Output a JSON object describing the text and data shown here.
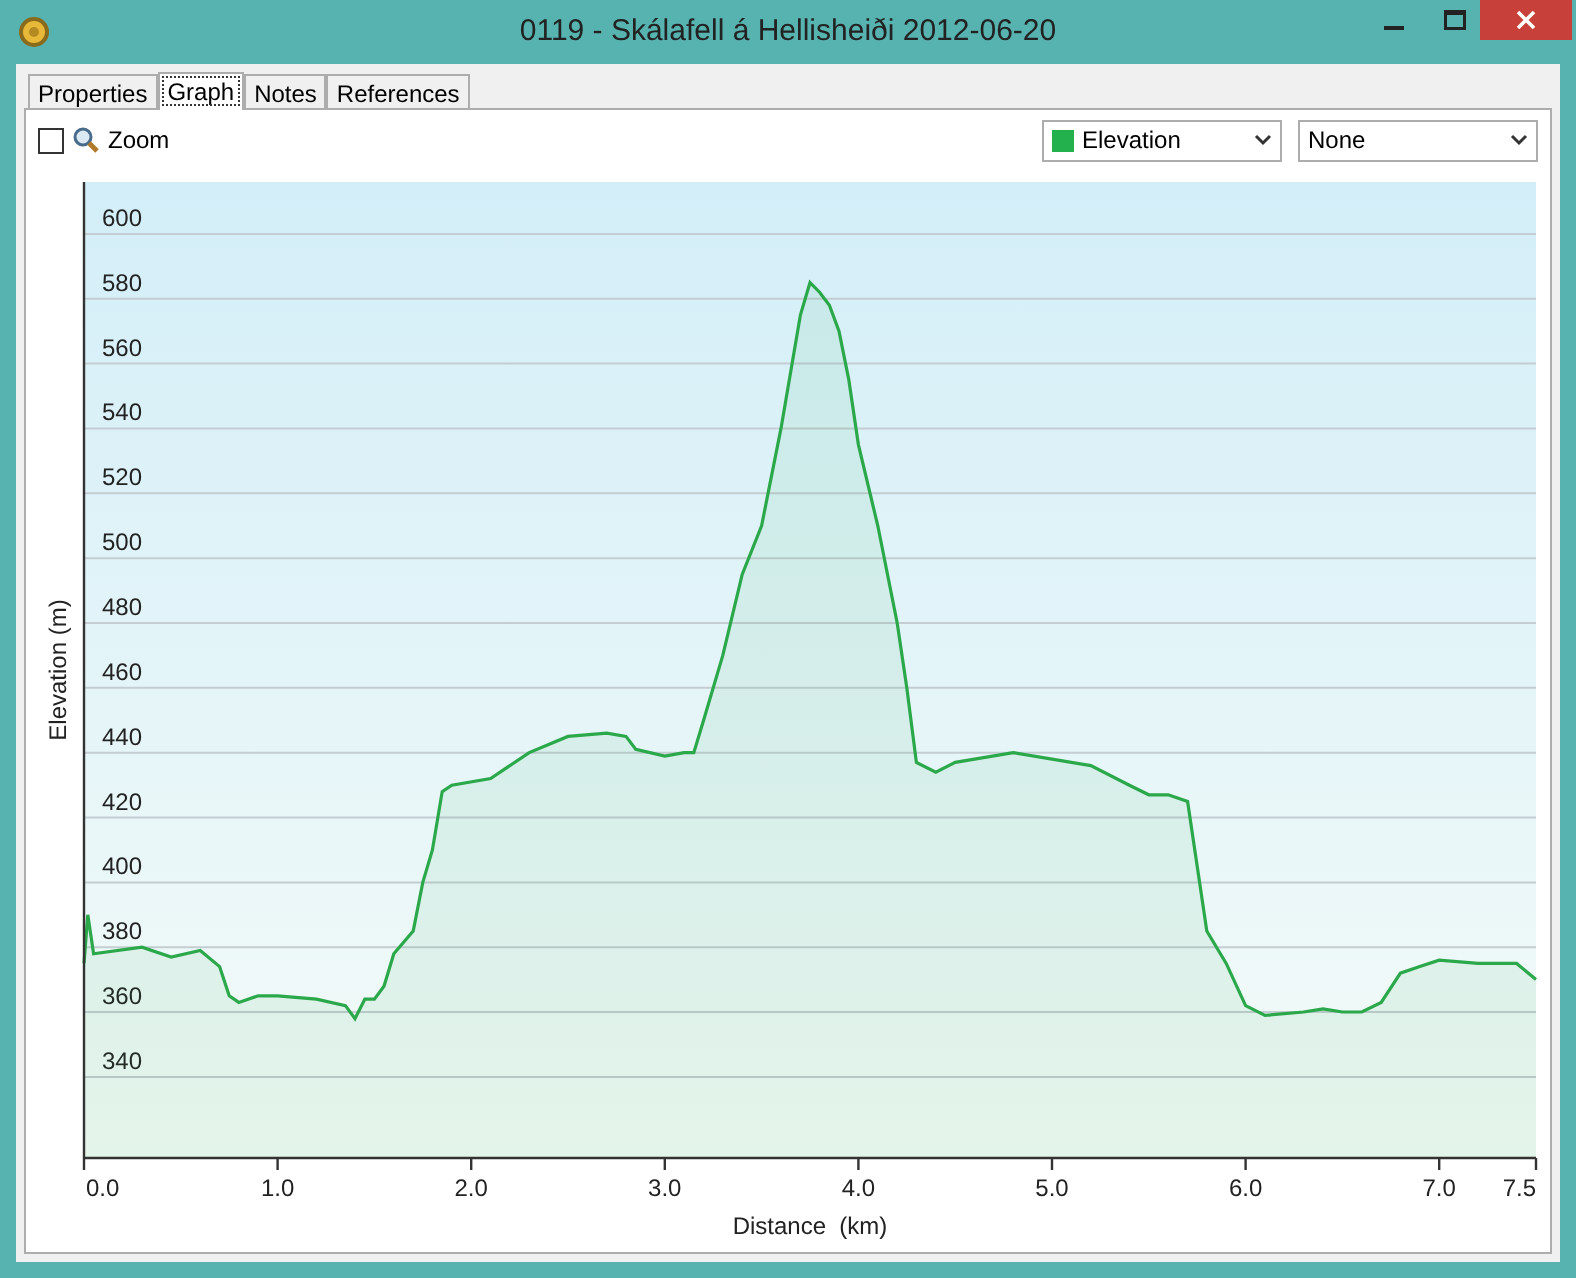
{
  "window": {
    "title": "0119 - Skálafell á Hellisheiði 2012-06-20"
  },
  "tabs": [
    {
      "label": "Properties",
      "selected": false
    },
    {
      "label": "Graph",
      "selected": true
    },
    {
      "label": "Notes",
      "selected": false
    },
    {
      "label": "References",
      "selected": false
    }
  ],
  "zoom": {
    "label": "Zoom",
    "checked": false
  },
  "dropdowns": [
    {
      "value": "Elevation",
      "color": "#22b14c"
    },
    {
      "value": "None"
    }
  ],
  "chart": {
    "chart_data": {
      "type": "area",
      "xlabel": "Distance  (km)",
      "ylabel": "Elevation (m)",
      "x": [
        0,
        0.02,
        0.05,
        0.3,
        0.45,
        0.6,
        0.7,
        0.75,
        0.8,
        0.9,
        1.0,
        1.2,
        1.35,
        1.4,
        1.45,
        1.5,
        1.55,
        1.6,
        1.7,
        1.75,
        1.8,
        1.85,
        1.9,
        2.1,
        2.3,
        2.5,
        2.7,
        2.8,
        2.85,
        3.0,
        3.1,
        3.15,
        3.2,
        3.3,
        3.4,
        3.5,
        3.6,
        3.7,
        3.75,
        3.8,
        3.85,
        3.9,
        3.95,
        4.0,
        4.1,
        4.2,
        4.25,
        4.3,
        4.4,
        4.5,
        4.6,
        4.8,
        5.0,
        5.2,
        5.4,
        5.5,
        5.6,
        5.7,
        5.75,
        5.8,
        5.9,
        6.0,
        6.1,
        6.3,
        6.4,
        6.5,
        6.6,
        6.7,
        6.8,
        6.9,
        7.0,
        7.2,
        7.4,
        7.5
      ],
      "grid": true,
      "series": [
        {
          "color": "#2aa84a",
          "values": [
            375,
            390,
            378,
            380,
            377,
            379,
            374,
            365,
            363,
            365,
            365,
            364,
            362,
            358,
            364,
            364,
            368,
            378,
            385,
            400,
            410,
            428,
            430,
            432,
            440,
            445,
            446,
            445,
            441,
            439,
            440,
            440,
            450,
            470,
            495,
            510,
            540,
            575,
            585,
            582,
            578,
            570,
            555,
            535,
            510,
            480,
            460,
            437,
            434,
            437,
            438,
            440,
            438,
            436,
            430,
            427,
            427,
            425,
            405,
            385,
            375,
            362,
            359,
            360,
            361,
            360,
            360,
            363,
            372,
            374,
            376,
            375,
            375,
            370
          ]
        }
      ],
      "xlim": [
        0,
        7.5
      ],
      "ylim": [
        315,
        616
      ],
      "xticks": [
        {
          "value": 0,
          "label": "0.0"
        },
        {
          "value": 1,
          "label": "1.0"
        },
        {
          "value": 2,
          "label": "2.0"
        },
        {
          "value": 3,
          "label": "3.0"
        },
        {
          "value": 4,
          "label": "4.0"
        },
        {
          "value": 5,
          "label": "5.0"
        },
        {
          "value": 6,
          "label": "6.0"
        },
        {
          "value": 7,
          "label": "7.0"
        },
        {
          "value": 7.5,
          "label": "7.5"
        }
      ],
      "yticks": [
        340,
        360,
        380,
        400,
        420,
        440,
        460,
        480,
        500,
        520,
        540,
        560,
        580,
        600
      ]
    }
  }
}
